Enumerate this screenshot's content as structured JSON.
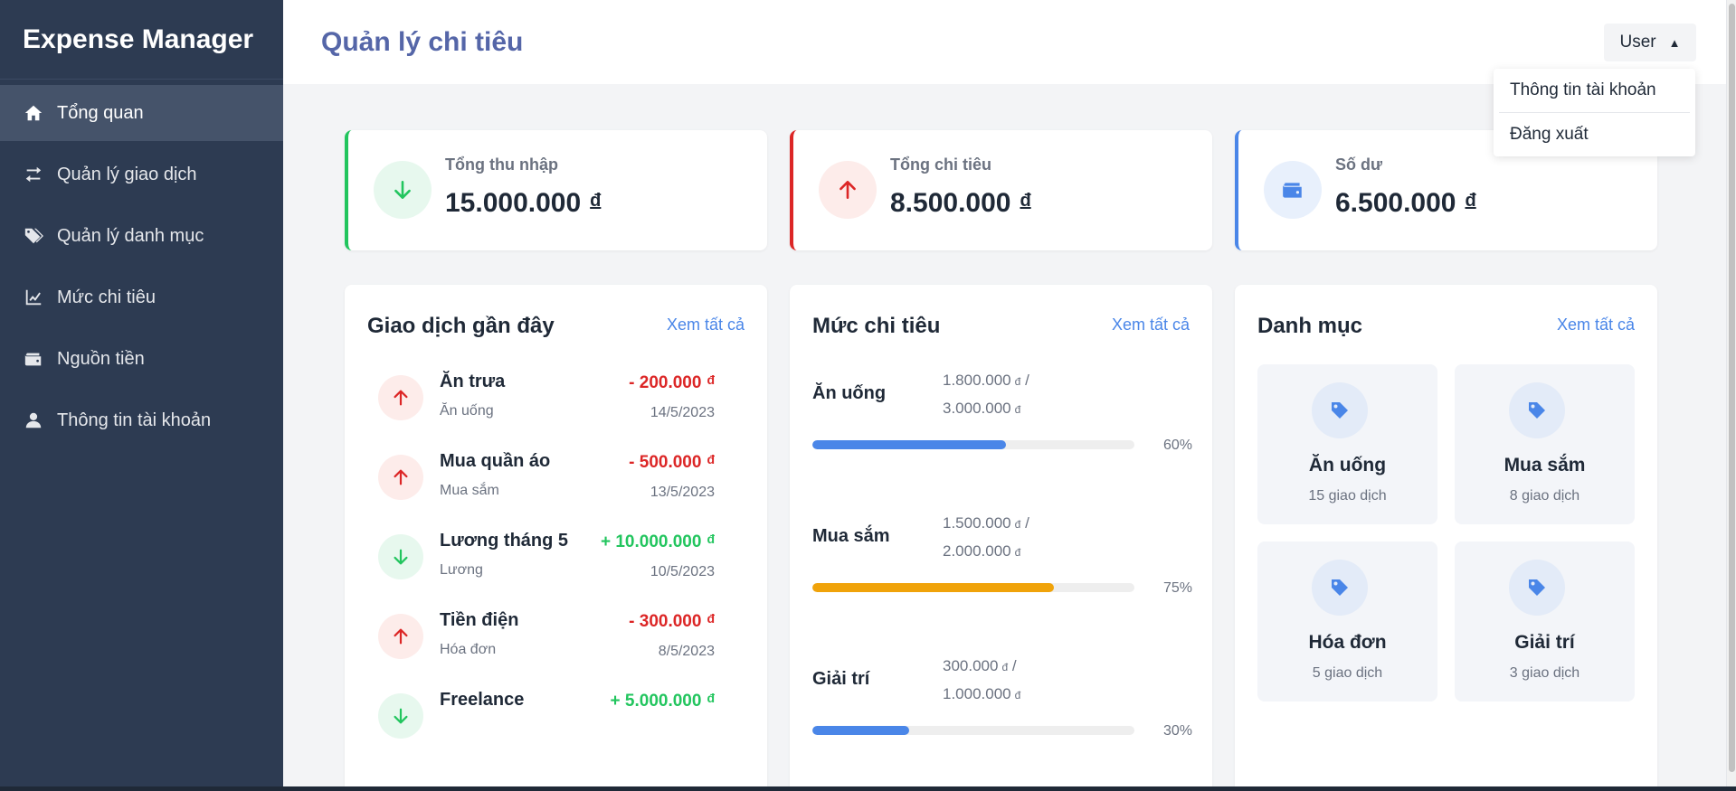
{
  "app": {
    "brand": "Expense Manager"
  },
  "sidebar": {
    "items": [
      {
        "label": "Tổng quan",
        "icon": "home-icon",
        "active": true
      },
      {
        "label": "Quản lý giao dịch",
        "icon": "exchange-icon",
        "active": false
      },
      {
        "label": "Quản lý danh mục",
        "icon": "tags-icon",
        "active": false
      },
      {
        "label": "Mức chi tiêu",
        "icon": "line-chart-icon",
        "active": false
      },
      {
        "label": "Nguồn tiền",
        "icon": "wallet-icon",
        "active": false
      },
      {
        "label": "Thông tin tài khoản",
        "icon": "user-icon",
        "active": false
      }
    ]
  },
  "header": {
    "title": "Quản lý chi tiêu",
    "user_label": "User",
    "user_caret": "▲",
    "dropdown": {
      "items": [
        "Thông tin tài khoản",
        "Đăng xuất"
      ]
    }
  },
  "summary": {
    "currency": "đ",
    "cards": [
      {
        "label": "Tổng thu nhập",
        "value": "15.000.000",
        "icon": "arrow-down-icon",
        "accent": "#22c55e"
      },
      {
        "label": "Tổng chi tiêu",
        "value": "8.500.000",
        "icon": "arrow-up-icon",
        "accent": "#dc2626"
      },
      {
        "label": "Số dư",
        "value": "6.500.000",
        "icon": "wallet-icon",
        "accent": "#4a86e8"
      }
    ]
  },
  "transactions": {
    "title": "Giao dịch gần đây",
    "link": "Xem tất cả",
    "items": [
      {
        "name": "Ăn trưa",
        "category": "Ăn uống",
        "amount": "- 200.000",
        "currency": "đ",
        "date": "14/5/2023",
        "type": "expense"
      },
      {
        "name": "Mua quần áo",
        "category": "Mua sắm",
        "amount": "- 500.000",
        "currency": "đ",
        "date": "13/5/2023",
        "type": "expense"
      },
      {
        "name": "Lương tháng 5",
        "category": "Lương",
        "amount": "+ 10.000.000",
        "currency": "đ",
        "date": "10/5/2023",
        "type": "income"
      },
      {
        "name": "Tiền điện",
        "category": "Hóa đơn",
        "amount": "- 300.000",
        "currency": "đ",
        "date": "8/5/2023",
        "type": "expense"
      },
      {
        "name": "Freelance",
        "category": "",
        "amount": "+ 5.000.000",
        "currency": "đ",
        "date": "",
        "type": "income"
      }
    ]
  },
  "budgets": {
    "title": "Mức chi tiêu",
    "link": "Xem tất cả",
    "items": [
      {
        "name": "Ăn uống",
        "spent": "1.800.000",
        "limit": "3.000.000",
        "currency": "đ",
        "sep": "/",
        "percent_label": "60%",
        "progress": 0.6,
        "color": "#4a86e8"
      },
      {
        "name": "Mua sắm",
        "spent": "1.500.000",
        "limit": "2.000.000",
        "currency": "đ",
        "sep": "/",
        "percent_label": "75%",
        "progress": 0.75,
        "color": "#f0a30a"
      },
      {
        "name": "Giải trí",
        "spent": "300.000",
        "limit": "1.000.000",
        "currency": "đ",
        "sep": "/",
        "percent_label": "30%",
        "progress": 0.3,
        "color": "#4a86e8"
      }
    ]
  },
  "categories": {
    "title": "Danh mục",
    "link": "Xem tất cả",
    "items": [
      {
        "name": "Ăn uống",
        "count": "15 giao dịch",
        "icon": "tag-icon"
      },
      {
        "name": "Mua sắm",
        "count": "8 giao dịch",
        "icon": "tag-icon"
      },
      {
        "name": "Hóa đơn",
        "count": "5 giao dịch",
        "icon": "tag-icon"
      },
      {
        "name": "Giải trí",
        "count": "3 giao dịch",
        "icon": "tag-icon"
      }
    ]
  }
}
